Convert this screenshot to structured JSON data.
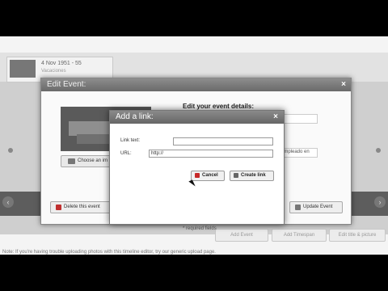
{
  "timeline": {
    "card_title": "4 Nov 1951 - 55",
    "card_subtitle": "Vacaciones",
    "buttons": [
      "Add Event",
      "Add Timespan",
      "Edit title & picture"
    ],
    "note": "Note: If you're having trouble uploading photos with this timeline editor, try our generic upload page."
  },
  "edit_event": {
    "title": "Edit Event:",
    "choose_image_label": "Choose an im",
    "details_heading": "Edit your event details:",
    "partial_field_text": "al Empleado en",
    "required_note": "* required fields",
    "delete_label": "Delete this event",
    "update_label": "Update Event"
  },
  "add_link": {
    "title": "Add a link:",
    "link_text_label": "Link text:",
    "link_text_value": "",
    "url_label": "URL:",
    "url_value": "http://",
    "cancel_label": "Cancel",
    "create_label": "Create link"
  }
}
